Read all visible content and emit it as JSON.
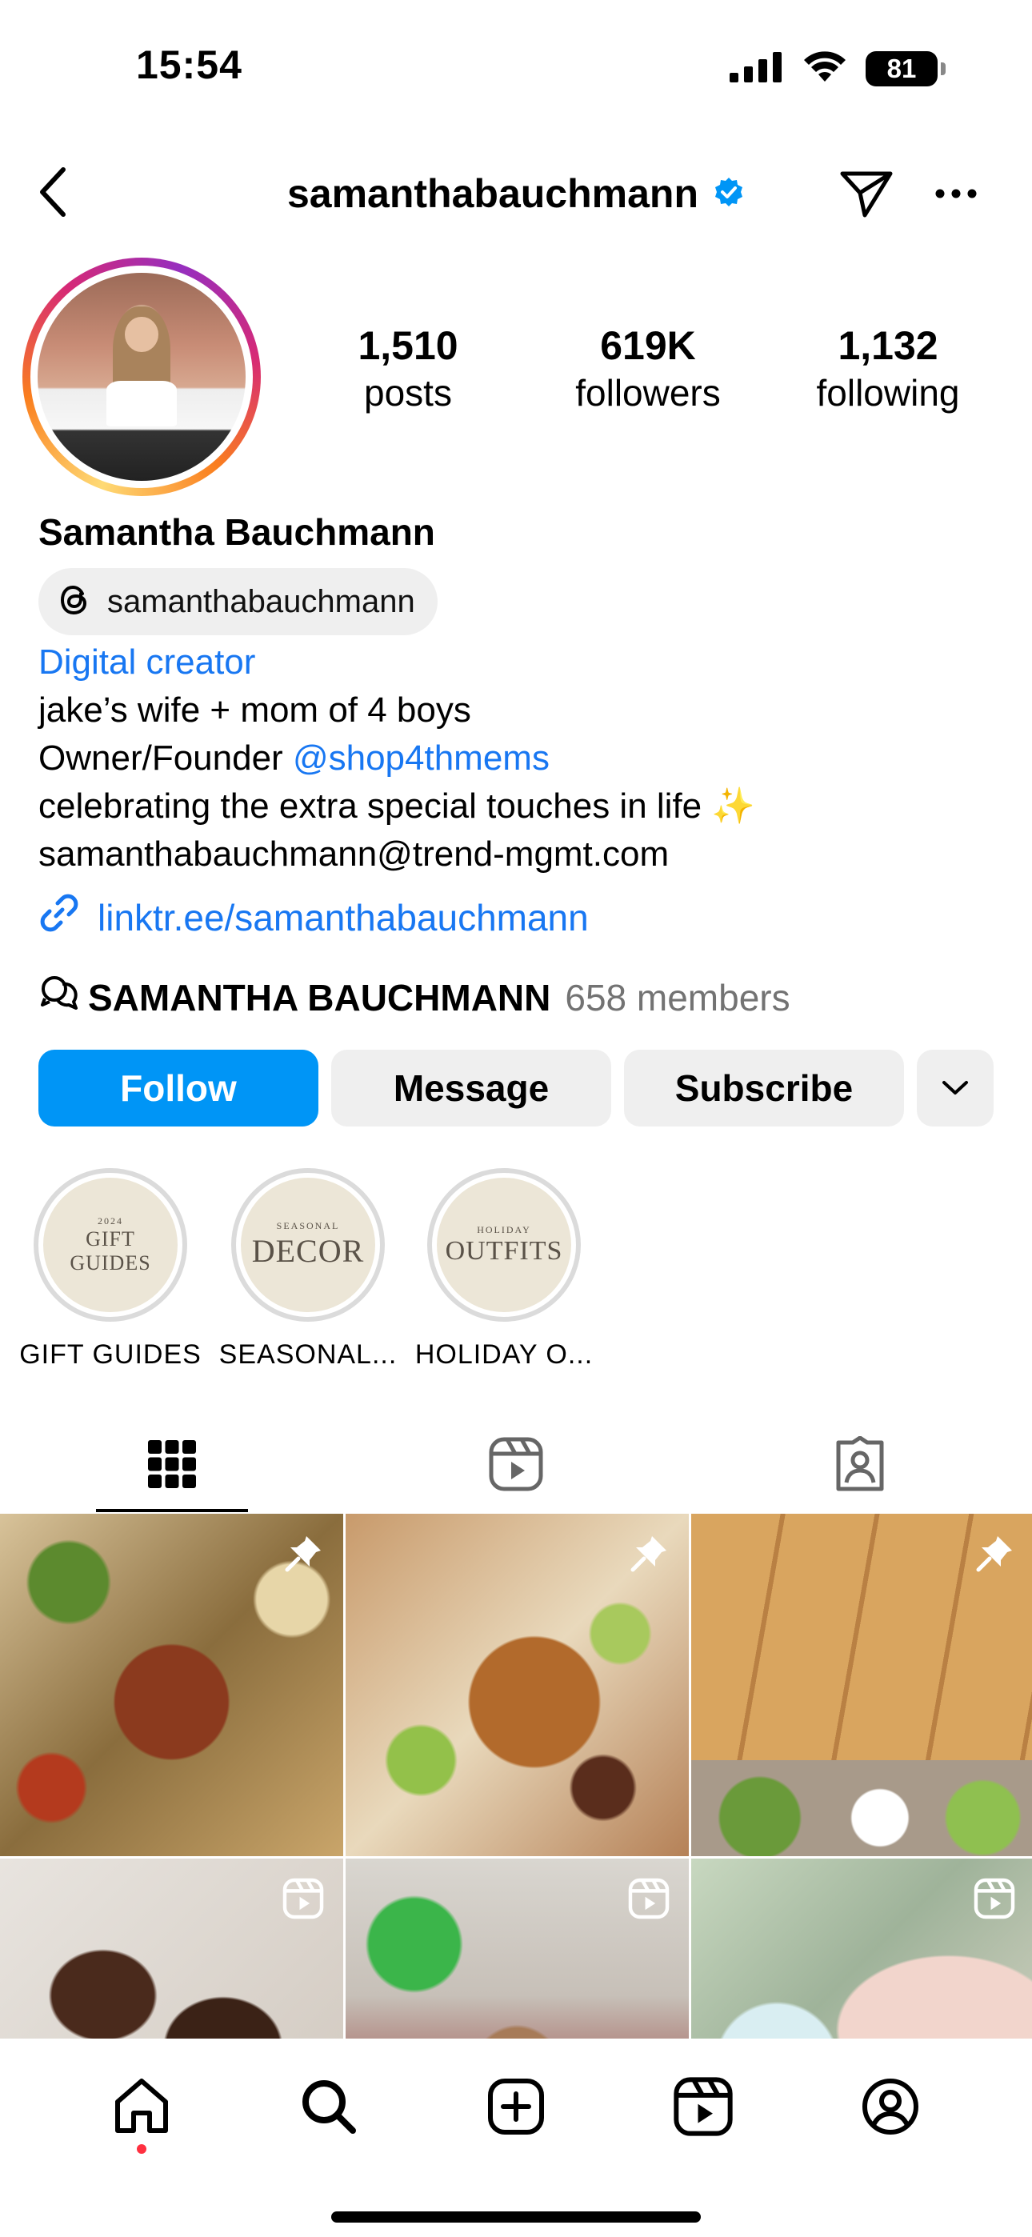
{
  "status_bar": {
    "time": "15:54",
    "battery": "81"
  },
  "header": {
    "username": "samanthabauchmann"
  },
  "profile": {
    "stats": [
      {
        "value": "1,510",
        "label": "posts"
      },
      {
        "value": "619K",
        "label": "followers"
      },
      {
        "value": "1,132",
        "label": "following"
      }
    ],
    "display_name": "Samantha Bauchmann",
    "threads_handle": "samanthabauchmann",
    "category": "Digital creator",
    "bio_line1": "jake’s wife + mom of 4 boys",
    "bio_line2_prefix": "Owner/Founder ",
    "bio_line2_mention": "@shop4thmems",
    "bio_line3": "celebrating the extra special touches in life ✨",
    "bio_line4": "samanthabauchmann@trend-mgmt.com",
    "link": "linktr.ee/samanthabauchmann"
  },
  "community": {
    "name": "SAMANTHA BAUCHMANN",
    "members": "658 members"
  },
  "actions": {
    "follow": "Follow",
    "message": "Message",
    "subscribe": "Subscribe"
  },
  "highlights": [
    {
      "small": "2024",
      "big": "GIFT GUIDES",
      "label": "GIFT GUIDES"
    },
    {
      "small": "SEASONAL",
      "big": "DECOR",
      "label": "SEASONAL..."
    },
    {
      "small": "HOLIDAY",
      "big": "OUTFITS",
      "label": "HOLIDAY O..."
    }
  ],
  "tabs": [
    "posts-grid",
    "reels",
    "tagged"
  ],
  "grid_tiles": [
    {
      "kind": "pinned"
    },
    {
      "kind": "pinned"
    },
    {
      "kind": "pinned"
    },
    {
      "kind": "reel"
    },
    {
      "kind": "reel"
    },
    {
      "kind": "reel"
    }
  ],
  "colors": {
    "accent": "#0095f6",
    "link": "#1877f2",
    "verified": "#0095f6",
    "notification": "#ff3040"
  }
}
